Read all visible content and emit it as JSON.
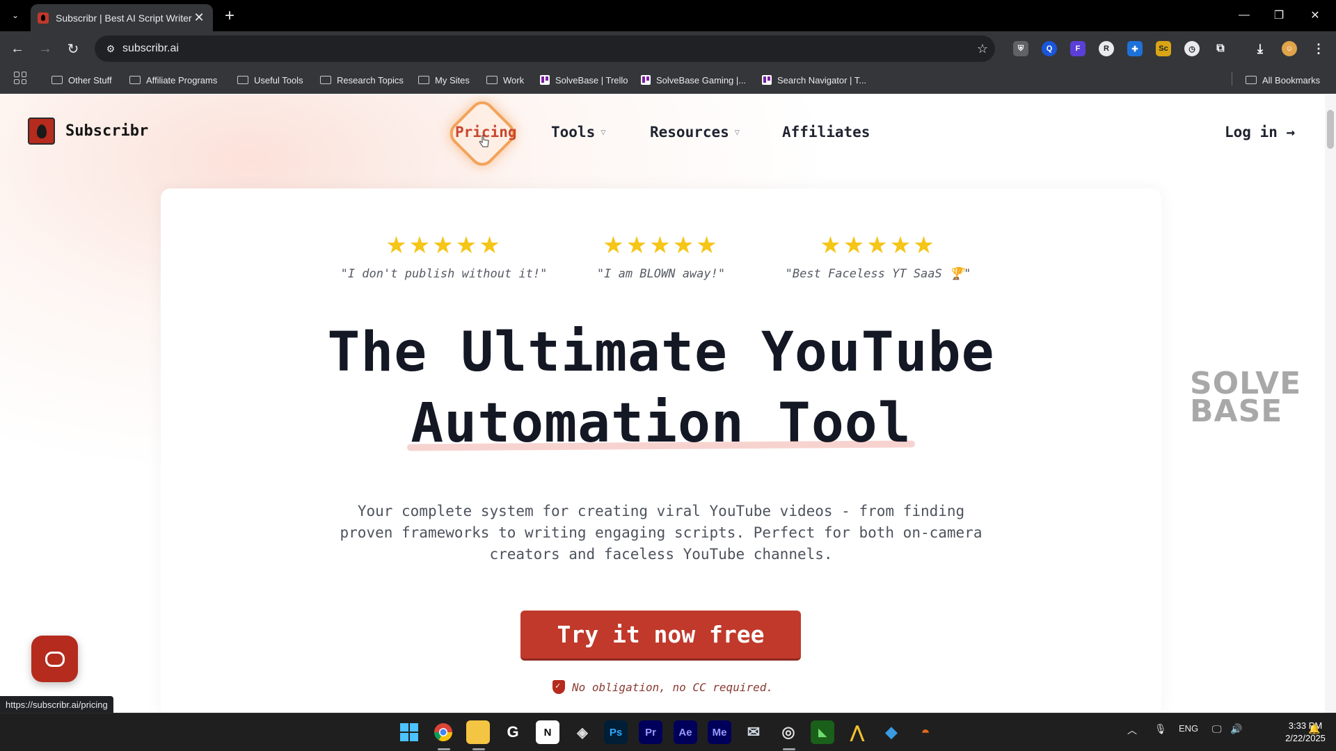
{
  "browser": {
    "tab_title": "Subscribr | Best AI Script Writer",
    "tab_close": "✕",
    "new_tab": "+",
    "url": "subscribr.ai",
    "status_url": "https://subscribr.ai/pricing",
    "window_controls": [
      "—",
      "❐",
      "✕"
    ],
    "bookmarks": [
      {
        "label": "Other Stuff",
        "icon": "folder-icon"
      },
      {
        "label": "Affiliate Programs",
        "icon": "folder-icon"
      },
      {
        "label": "Useful Tools",
        "icon": "folder-icon"
      },
      {
        "label": "Research Topics",
        "icon": "folder-icon"
      },
      {
        "label": "My Sites",
        "icon": "folder-icon"
      },
      {
        "label": "Work",
        "icon": "folder-icon"
      },
      {
        "label": "SolveBase | Trello",
        "icon": "trello-icon"
      },
      {
        "label": "SolveBase Gaming |...",
        "icon": "trello-icon"
      },
      {
        "label": "Search Navigator | T...",
        "icon": "trello-icon"
      }
    ],
    "all_bookmarks": "All Bookmarks"
  },
  "site": {
    "name": "Subscribr",
    "nav": {
      "pricing": "Pricing",
      "tools": "Tools",
      "resources": "Resources",
      "affiliates": "Affiliates",
      "login": "Log in →"
    },
    "reviews": [
      {
        "stars": "★★★★★",
        "rating": 5,
        "quote": "\"I don't publish without it!\""
      },
      {
        "stars": "★★★★★",
        "rating": 5,
        "quote": "\"I am BLOWN away!\""
      },
      {
        "stars": "★★★★★",
        "rating": 5,
        "quote": "\"Best Faceless YT SaaS 🏆\""
      }
    ],
    "headline_line1": "The Ultimate YouTube",
    "headline_line2": "Automation Tool",
    "subtext": "Your complete system for creating viral YouTube videos - from finding proven frameworks to writing engaging scripts. Perfect for both on-camera creators and faceless YouTube channels.",
    "cta": "Try it now free",
    "no_obligation": "No obligation, no CC required.",
    "watermark": "SOLVE BASE"
  },
  "taskbar": {
    "language": "ENG",
    "time": "3:33 PM",
    "date": "2/22/2025",
    "apps": [
      "Ps",
      "Pr",
      "Ae",
      "Me"
    ]
  },
  "colors": {
    "brand": "#c0392b",
    "star": "#f5c518",
    "chrome_dark": "#35363a"
  }
}
